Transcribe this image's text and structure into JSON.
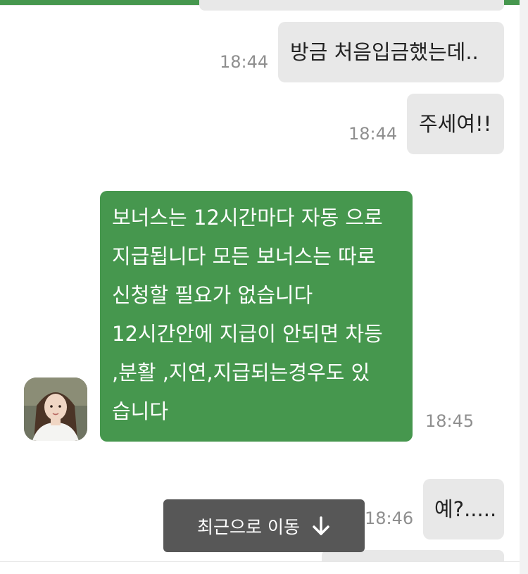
{
  "messages": [
    {
      "direction": "outgoing",
      "text": "방금 처음입금했는데..",
      "time": "18:44"
    },
    {
      "direction": "outgoing",
      "text": "주세여!!",
      "time": "18:44"
    },
    {
      "direction": "incoming",
      "lines": [
        "보너스는 12시간마다 자동 으로",
        "지급됩니다 모든 보너스는 따로",
        "신청할 필요가 없습니다",
        "12시간안에 지급이 안되면 차등",
        ",분활 ,지연,지급되는경우도 있",
        "습니다"
      ],
      "time": "18:45"
    },
    {
      "direction": "outgoing",
      "text": "예?.....",
      "time": "18:46"
    }
  ],
  "jump_button": {
    "label": "최근으로 이동",
    "icon": "arrow-down-icon"
  },
  "colors": {
    "incoming_bubble": "#46974e",
    "outgoing_bubble": "#e8e8e8",
    "top_bar": "#46974e",
    "jump_button": "#575757"
  }
}
